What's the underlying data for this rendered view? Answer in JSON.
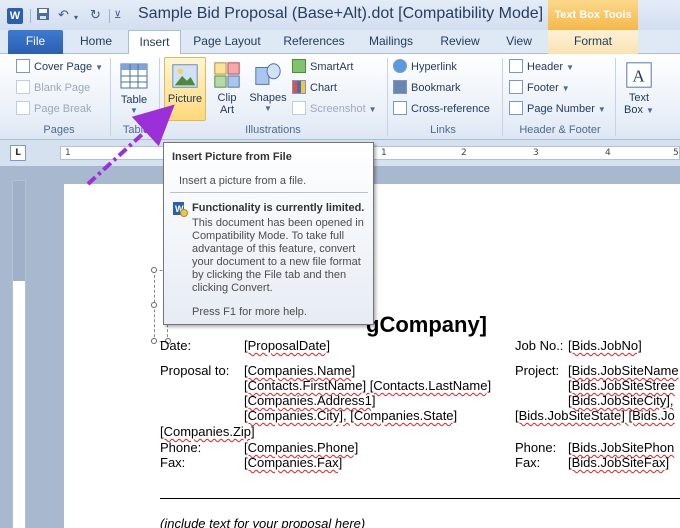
{
  "titlebar": {
    "app_icon": "W",
    "doc_title": "Sample Bid Proposal (Base+Alt).dot [Compatibility Mode]  M",
    "context_group": "Text Box Tools"
  },
  "tabs": {
    "file": "File",
    "home": "Home",
    "insert": "Insert",
    "page_layout": "Page Layout",
    "references": "References",
    "mailings": "Mailings",
    "review": "Review",
    "view": "View",
    "format": "Format"
  },
  "ribbon": {
    "pages": {
      "label": "Pages",
      "cover_page": "Cover Page",
      "blank_page": "Blank Page",
      "page_break": "Page Break"
    },
    "tables": {
      "label": "Table",
      "table": "Table"
    },
    "illustrations": {
      "label": "Illustrations",
      "picture": "Picture",
      "clip_art_1": "Clip",
      "clip_art_2": "Art",
      "shapes": "Shapes",
      "smartart": "SmartArt",
      "chart": "Chart",
      "screenshot": "Screenshot"
    },
    "links": {
      "label": "Links",
      "hyperlink": "Hyperlink",
      "bookmark": "Bookmark",
      "cross_reference": "Cross-reference"
    },
    "header_footer": {
      "label": "Header & Footer",
      "header": "Header",
      "footer": "Footer",
      "page_number": "Page Number"
    },
    "text": {
      "text_box_1": "Text",
      "text_box_2": "Box"
    }
  },
  "ruler": {
    "corner": "L",
    "numbers": [
      "1",
      "1",
      "2",
      "3",
      "4",
      "5"
    ]
  },
  "document": {
    "heading": "gCompany]",
    "date_label": "Date:",
    "date_value": "[ProposalDate]",
    "jobno_label": "Job No.:",
    "jobno_value": "[Bids.JobNo]",
    "proposal_label": "Proposal to:",
    "proposal_lines": [
      "[Companies.Name]",
      "[Contacts.FirstName] [Contacts.LastName]",
      "[Companies.Address1]",
      "[Companies.City], [Companies.State]"
    ],
    "zip": "[Companies.Zip]",
    "project_label": "Project:",
    "project_lines": [
      "[Bids.JobSiteName",
      "[Bids.JobSiteStree",
      "[Bids.JobSiteCity],"
    ],
    "project_state": "[Bids.JobSiteState] [Bids.Jo",
    "phone_label": "Phone:",
    "phone_value": "[Companies.Phone]",
    "fax_label": "Fax:",
    "fax_value": "[Companies.Fax]",
    "site_phone_label": "Phone:",
    "site_phone_value": "[Bids.JobSitePhon",
    "site_fax_label": "Fax:",
    "site_fax_value": "[Bids.JobSiteFax]",
    "footer_text": "(include text for your proposal here)"
  },
  "tooltip": {
    "title": "Insert Picture from File",
    "description": "Insert a picture from a file.",
    "warning_title": "Functionality is currently limited.",
    "warning_body": "This document has been opened in Compatibility Mode. To take full advantage of this feature, convert your document to a new file format by clicking the File tab and then clicking Convert.",
    "help": "Press F1 for more help."
  },
  "colors": {
    "accent": "#2a5fb0",
    "highlight": "#ffd978",
    "annotation_arrow": "#9b30d9"
  }
}
